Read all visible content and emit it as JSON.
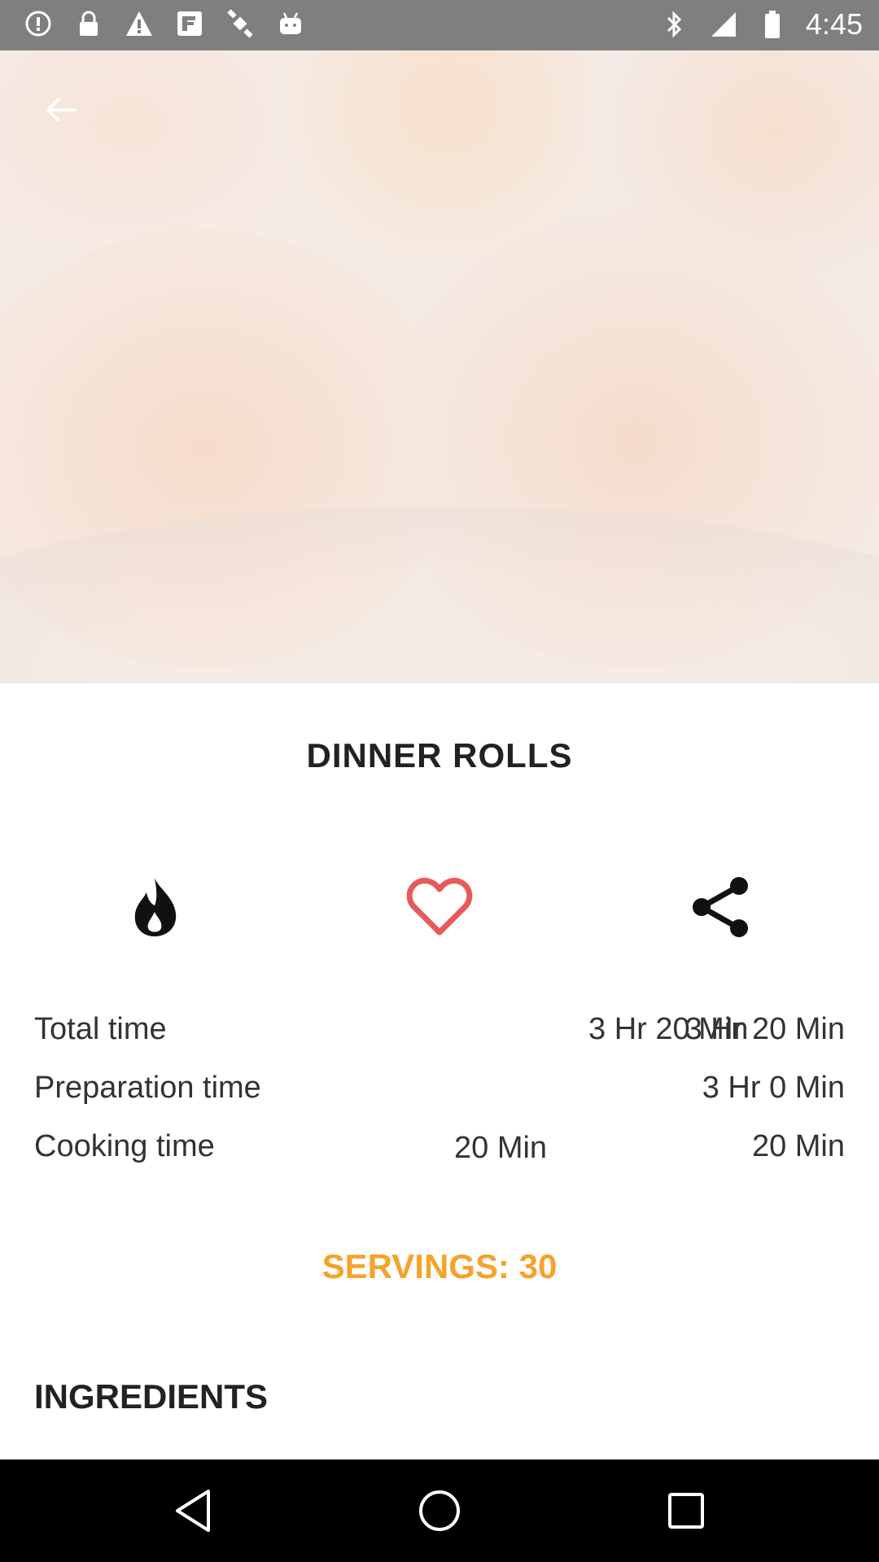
{
  "status_bar": {
    "time": "4:45",
    "left_icons": [
      "alert-circle-icon",
      "lock-icon",
      "warning-icon",
      "fake-gps-icon",
      "satellite-icon",
      "android-icon"
    ],
    "right_icons": [
      "bluetooth-icon",
      "signal-icon",
      "battery-icon"
    ]
  },
  "recipe": {
    "title": "DINNER ROLLS",
    "actions": [
      "fire-icon",
      "heart-icon",
      "share-icon"
    ],
    "times": [
      {
        "label": "Total time",
        "value": "3 Hr 20 Min",
        "overlap_value": "3 Hr 20 Min"
      },
      {
        "label": "Preparation time",
        "value": "3 Hr 0 Min"
      },
      {
        "label": "Cooking time",
        "value": "20 Min",
        "mid_value": "20 Min"
      }
    ],
    "servings": "SERVINGS: 30",
    "ingredients_heading": "INGREDIENTS"
  },
  "colors": {
    "accent": "#f5a32a",
    "heart": "#e85a5a",
    "status_bar": "#7f7f7f",
    "nav_bar": "#000000"
  },
  "nav": [
    "back-triangle-icon",
    "home-circle-icon",
    "recents-square-icon"
  ]
}
